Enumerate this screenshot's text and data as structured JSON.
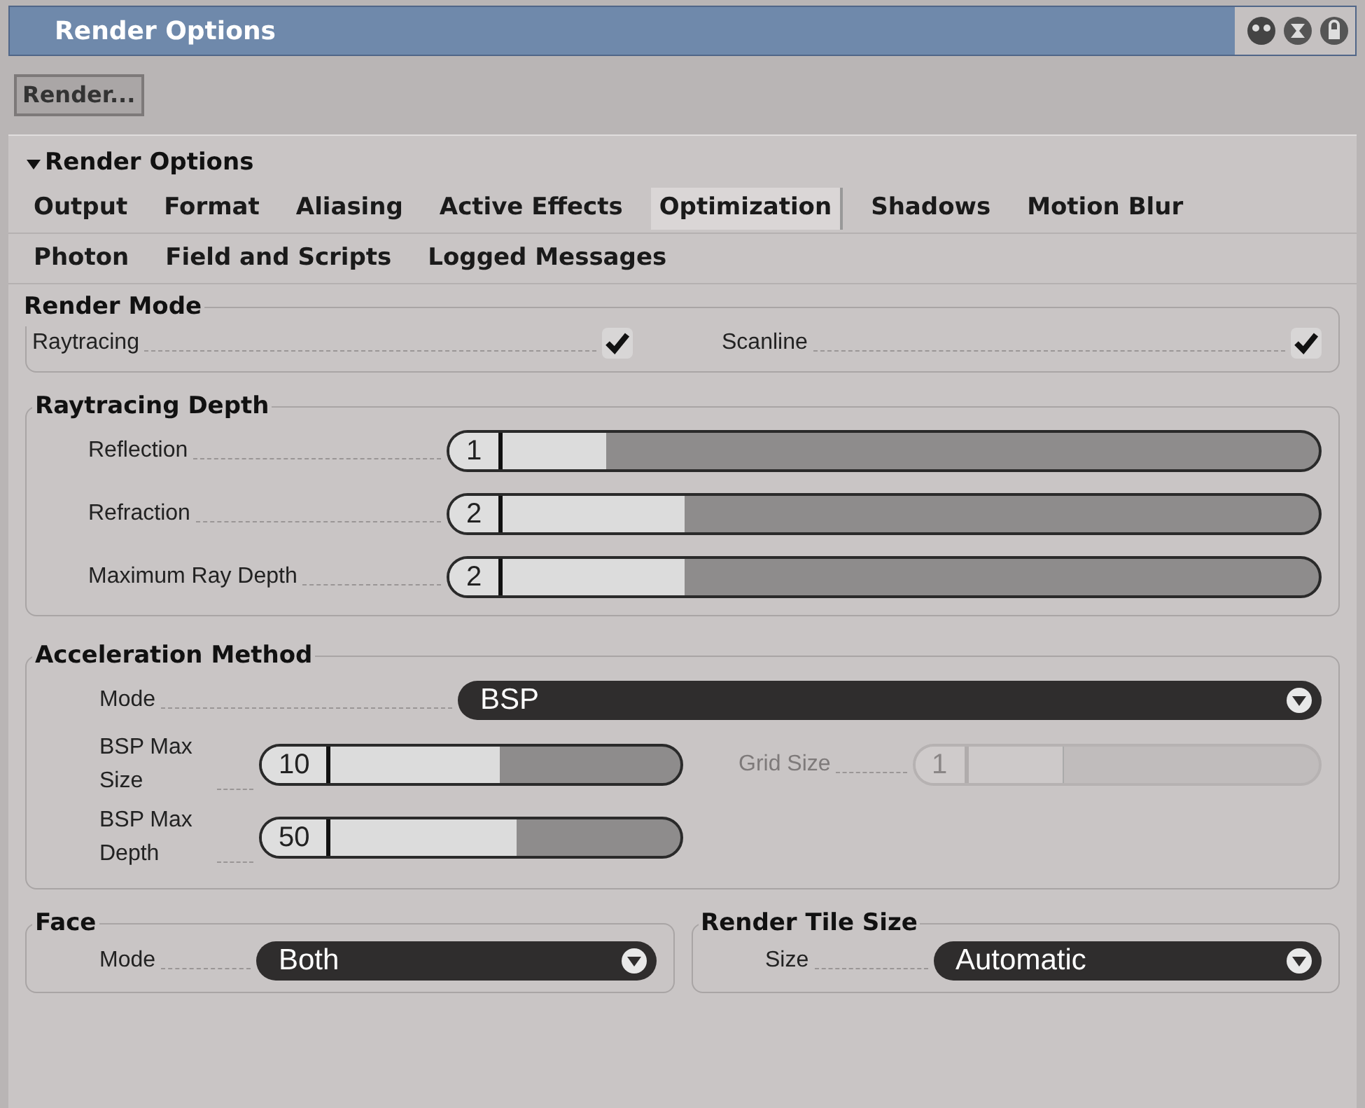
{
  "window": {
    "title": "Render Options"
  },
  "toolbar": {
    "render_button": "Render..."
  },
  "section": {
    "title": "Render Options",
    "expanded": true
  },
  "tab_rows": [
    [
      {
        "label": "Output",
        "selected": false
      },
      {
        "label": "Format",
        "selected": false
      },
      {
        "label": "Aliasing",
        "selected": false
      },
      {
        "label": "Active Effects",
        "selected": false
      },
      {
        "label": "Optimization",
        "selected": true
      },
      {
        "label": "Shadows",
        "selected": false
      },
      {
        "label": "Motion Blur",
        "selected": false
      }
    ],
    [
      {
        "label": "Photon",
        "selected": false
      },
      {
        "label": "Field and Scripts",
        "selected": false
      },
      {
        "label": "Logged Messages",
        "selected": false
      }
    ]
  ],
  "render_mode": {
    "title": "Render Mode",
    "options": [
      {
        "label": "Raytracing",
        "checked": true
      },
      {
        "label": "Scanline",
        "checked": true
      }
    ]
  },
  "raytracing_depth": {
    "title": "Raytracing Depth",
    "sliders": [
      {
        "label": "Reflection",
        "value": "1",
        "level": 0.18
      },
      {
        "label": "Refraction",
        "value": "2",
        "level": 0.27
      },
      {
        "label": "Maximum Ray Depth",
        "value": "2",
        "level": 0.27
      }
    ]
  },
  "acceleration": {
    "title": "Acceleration Method",
    "mode": {
      "label": "Mode",
      "value": "BSP"
    },
    "sliders": [
      {
        "label": "BSP Max Size",
        "value": "10",
        "level": 0.57,
        "disabled": false
      },
      {
        "label": "Grid Size",
        "value": "1",
        "level": 0.37,
        "disabled": true
      },
      {
        "label": "BSP Max Depth",
        "value": "50",
        "level": 0.61,
        "disabled": false
      }
    ]
  },
  "face": {
    "title": "Face",
    "mode": {
      "label": "Mode",
      "value": "Both"
    }
  },
  "render_tile_size": {
    "title": "Render Tile Size",
    "size": {
      "label": "Size",
      "value": "Automatic"
    }
  }
}
